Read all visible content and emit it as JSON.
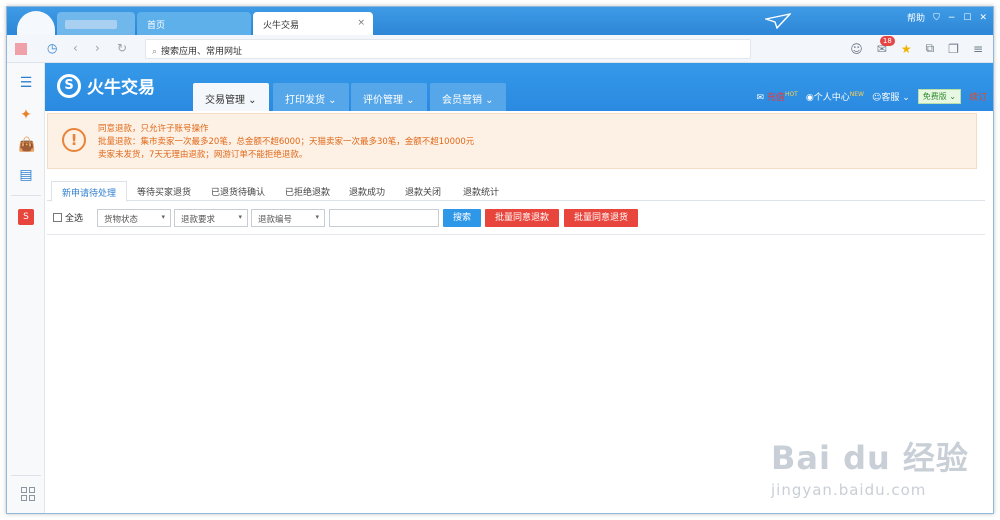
{
  "browser": {
    "tabs": [
      {
        "label": ""
      },
      {
        "label": "首页"
      },
      {
        "label": "火牛交易",
        "close": "×"
      }
    ],
    "right_controls": {
      "help": "帮助",
      "shirt": "⛉",
      "minimize": "−",
      "maximize": "☐",
      "close": "✕"
    },
    "address_placeholder": "搜索应用、常用网址",
    "mail_badge": "18"
  },
  "app": {
    "brand_name": "火牛交易",
    "menus": [
      {
        "label": "交易管理 ⌄"
      },
      {
        "label": "打印发货 ⌄"
      },
      {
        "label": "评价管理 ⌄"
      },
      {
        "label": "会员营销 ⌄"
      }
    ],
    "header_right": {
      "recharge": "充值",
      "personal": "个人中心",
      "service": "客服 ⌄",
      "free_version": "免费版 ⌄",
      "renew": "续订",
      "hot_tag": "HOT",
      "new_tag": "NEW"
    }
  },
  "notice": {
    "lines": [
      "同意退款，只允许子账号操作",
      "批量退款：集市卖家一次最多20笔，总金额不超6000；天猫卖家一次最多30笔，金额不超10000元",
      "卖家未发货，7天无理由退款；网游订单不能拒绝退款。"
    ]
  },
  "subtabs": [
    {
      "label": "新申请待处理"
    },
    {
      "label": "等待买家退货"
    },
    {
      "label": "已退货待确认"
    },
    {
      "label": "已拒绝退款"
    },
    {
      "label": "退款成功"
    },
    {
      "label": "退款关闭"
    },
    {
      "label": "退款统计"
    }
  ],
  "filters": {
    "select_all": "全选",
    "goods_status": "货物状态",
    "refund_request": "退款要求",
    "refund_number": "退款编号",
    "search_button": "搜索",
    "batch_refund": "批量同意退款",
    "batch_return": "批量同意退货"
  },
  "watermark": {
    "line1": "Bai du 经验",
    "line2": "jingyan.baidu.com"
  },
  "colors": {
    "primary": "#2b8ae0",
    "notice_bg": "#fdf0e4",
    "notice_text": "#e06a1b",
    "danger": "#e8453c"
  }
}
